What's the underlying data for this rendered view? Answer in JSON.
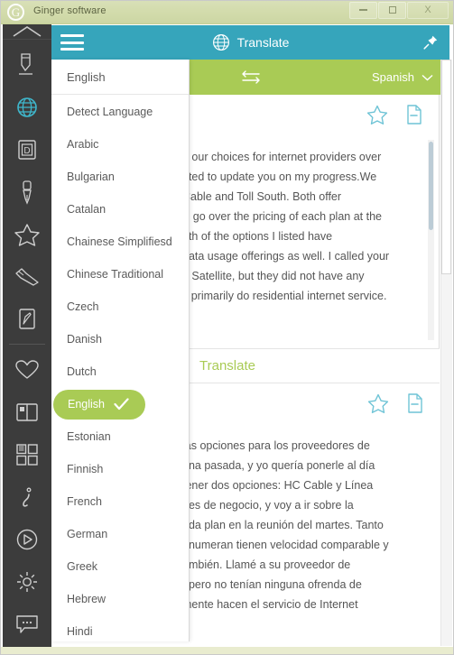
{
  "window": {
    "app_title": "Ginger software",
    "logo_letter": "G",
    "controls": {
      "minimize": "minimize-button",
      "maximize": "maximize-button",
      "close": "X"
    }
  },
  "header": {
    "menu_icon": "hamburger-icon",
    "globe_icon": "globe-icon",
    "title": "Translate",
    "pin_icon": "pin-icon",
    "teal_color": "#36a5bb"
  },
  "language_bar": {
    "source_language": "English",
    "swap_icon": "swap-arrows-icon",
    "target_language": "Spanish",
    "chevron_icon": "chevron-down-icon",
    "green_color": "#a9cb55"
  },
  "source_panel": {
    "favorite_icon": "star-icon",
    "copy_icon": "copy-document-icon",
    "text": "g our choices for internet providers over\nnted to update you on my progress.We\nCable and Toll South. Both offer\nill go over the pricing of each plan at the\noth of the options I listed have\ndata usage offerings as well. I called your\no Satellite, but they did not have any\ny primarily do residential internet service."
  },
  "translate_button": {
    "label": "Translate"
  },
  "target_panel": {
    "favorite_icon": "star-icon",
    "copy_icon": "copy-document-icon",
    "text": "las opciones para los proveedores de\nana pasada, y yo quería ponerle al día\ntener dos opciones: HC Cable y Línea\nnes de negocio, y voy a ir sobre la\nada plan en la reunión del martes. Tanto\nenumeran tienen velocidad comparable y\nambién. Llamé a su proveedor de\n, pero no tenían ninguna ofrenda de\nmente hacen el servicio de Internet"
  },
  "language_dropdown": {
    "current": "English",
    "items": [
      {
        "label": "Detect Language",
        "selected": false
      },
      {
        "label": "Arabic",
        "selected": false
      },
      {
        "label": "Bulgarian",
        "selected": false
      },
      {
        "label": "Catalan",
        "selected": false
      },
      {
        "label": "Chainese Simplifiesd",
        "selected": false
      },
      {
        "label": "Chinese Traditional",
        "selected": false
      },
      {
        "label": "Czech",
        "selected": false
      },
      {
        "label": "Danish",
        "selected": false
      },
      {
        "label": "Dutch",
        "selected": false
      },
      {
        "label": "English",
        "selected": true
      },
      {
        "label": "Estonian",
        "selected": false
      },
      {
        "label": "Finnish",
        "selected": false
      },
      {
        "label": "French",
        "selected": false
      },
      {
        "label": "German",
        "selected": false
      },
      {
        "label": "Greek",
        "selected": false
      },
      {
        "label": "Hebrew",
        "selected": false
      },
      {
        "label": "Hindi",
        "selected": false
      }
    ],
    "check_icon": "check-icon"
  },
  "sidebar": {
    "collapse_up_icon": "chevron-up-icon",
    "collapse_down_icon": "chevron-down-icon",
    "items": [
      {
        "icon": "proofread-pen-icon",
        "active": false
      },
      {
        "icon": "globe-translate-icon",
        "active": true
      },
      {
        "icon": "dictionary-icon",
        "active": false
      },
      {
        "icon": "grammar-pen-icon",
        "active": false
      },
      {
        "icon": "favorites-star-icon",
        "active": false
      },
      {
        "icon": "rephrase-icon",
        "active": false
      },
      {
        "icon": "text-editor-icon",
        "active": false
      },
      {
        "icon": "heart-icon",
        "active": false
      },
      {
        "icon": "book-icon",
        "active": false
      },
      {
        "icon": "grid-apps-icon",
        "active": false
      },
      {
        "icon": "info-icon",
        "active": false
      },
      {
        "icon": "play-icon",
        "active": false
      },
      {
        "icon": "settings-gear-icon",
        "active": false
      },
      {
        "icon": "chat-bubble-icon",
        "active": false
      }
    ],
    "active_color": "#36a5bb"
  }
}
